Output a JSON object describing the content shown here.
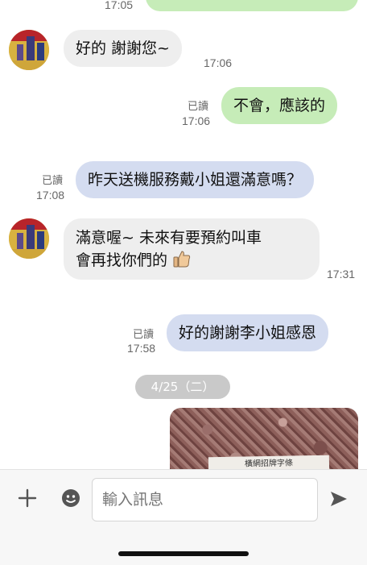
{
  "messages": [
    {
      "time": "17:05"
    },
    {
      "text": "好的 謝謝您~",
      "time": "17:06"
    },
    {
      "text": "不會，應該的",
      "read": "已讀",
      "time": "17:06"
    },
    {
      "text": "昨天送機服務戴小姐還滿意嗎？",
      "read": "已讀",
      "time": "17:08"
    },
    {
      "line1": "滿意喔~ 未來有要預約叫車",
      "line2": "會再找你們的",
      "time": "17:31"
    },
    {
      "text": "好的謝謝李小姐感恩",
      "read": "已讀",
      "time": "17:58"
    }
  ],
  "date_separator": "4/25（二）",
  "photo_label": "橫網招牌字條",
  "composer": {
    "placeholder": "輸入訊息"
  },
  "colors": {
    "green_bubble": "#c6ecb8",
    "blue_bubble": "#d4dcf0",
    "incoming_bubble": "#eeeeee"
  },
  "icons": [
    "plus-icon",
    "sticker-icon",
    "send-icon",
    "thumbs-up-icon"
  ]
}
